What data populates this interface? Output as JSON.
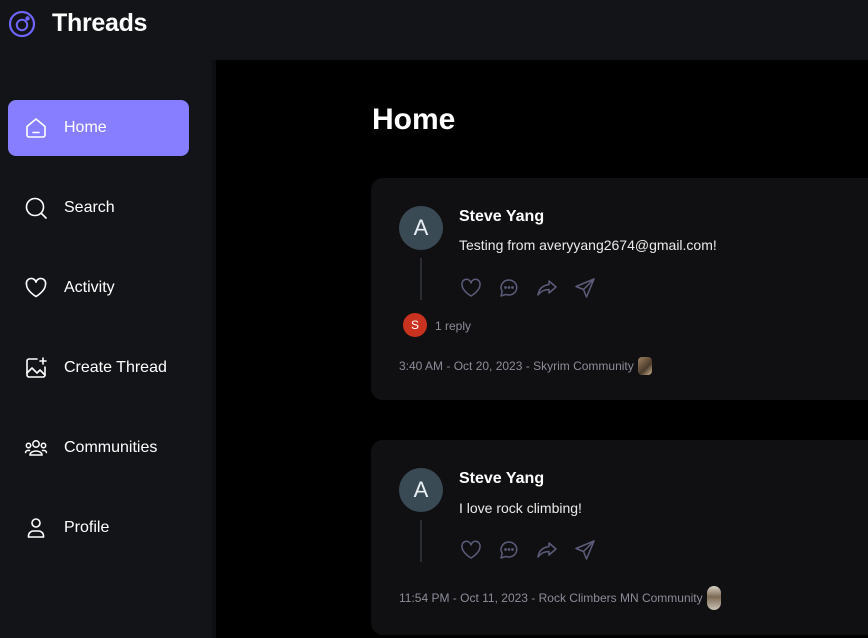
{
  "app": {
    "title": "Threads"
  },
  "sidebar": {
    "items": [
      {
        "label": "Home",
        "icon": "home-icon",
        "active": true
      },
      {
        "label": "Search",
        "icon": "search-icon",
        "active": false
      },
      {
        "label": "Activity",
        "icon": "heart-icon",
        "active": false
      },
      {
        "label": "Create Thread",
        "icon": "create-thread-icon",
        "active": false
      },
      {
        "label": "Communities",
        "icon": "communities-icon",
        "active": false
      },
      {
        "label": "Profile",
        "icon": "profile-icon",
        "active": false
      }
    ]
  },
  "main": {
    "title": "Home",
    "threads": [
      {
        "avatar_initial": "A",
        "author": "Steve Yang",
        "text": "Testing from averyyang2674@gmail.com!",
        "reply_avatar_initial": "S",
        "replies": "1 reply",
        "meta": "3:40 AM - Oct 20, 2023 - Skyrim Community"
      },
      {
        "avatar_initial": "A",
        "author": "Steve Yang",
        "text": "I love rock climbing!",
        "meta": "11:54 PM - Oct 11, 2023 - Rock Climbers MN Community"
      }
    ]
  },
  "colors": {
    "accent": "#877eff",
    "panel": "#121417",
    "card": "#101012",
    "muted_text": "#8c8c99",
    "reply_avatar": "#c8321e"
  }
}
